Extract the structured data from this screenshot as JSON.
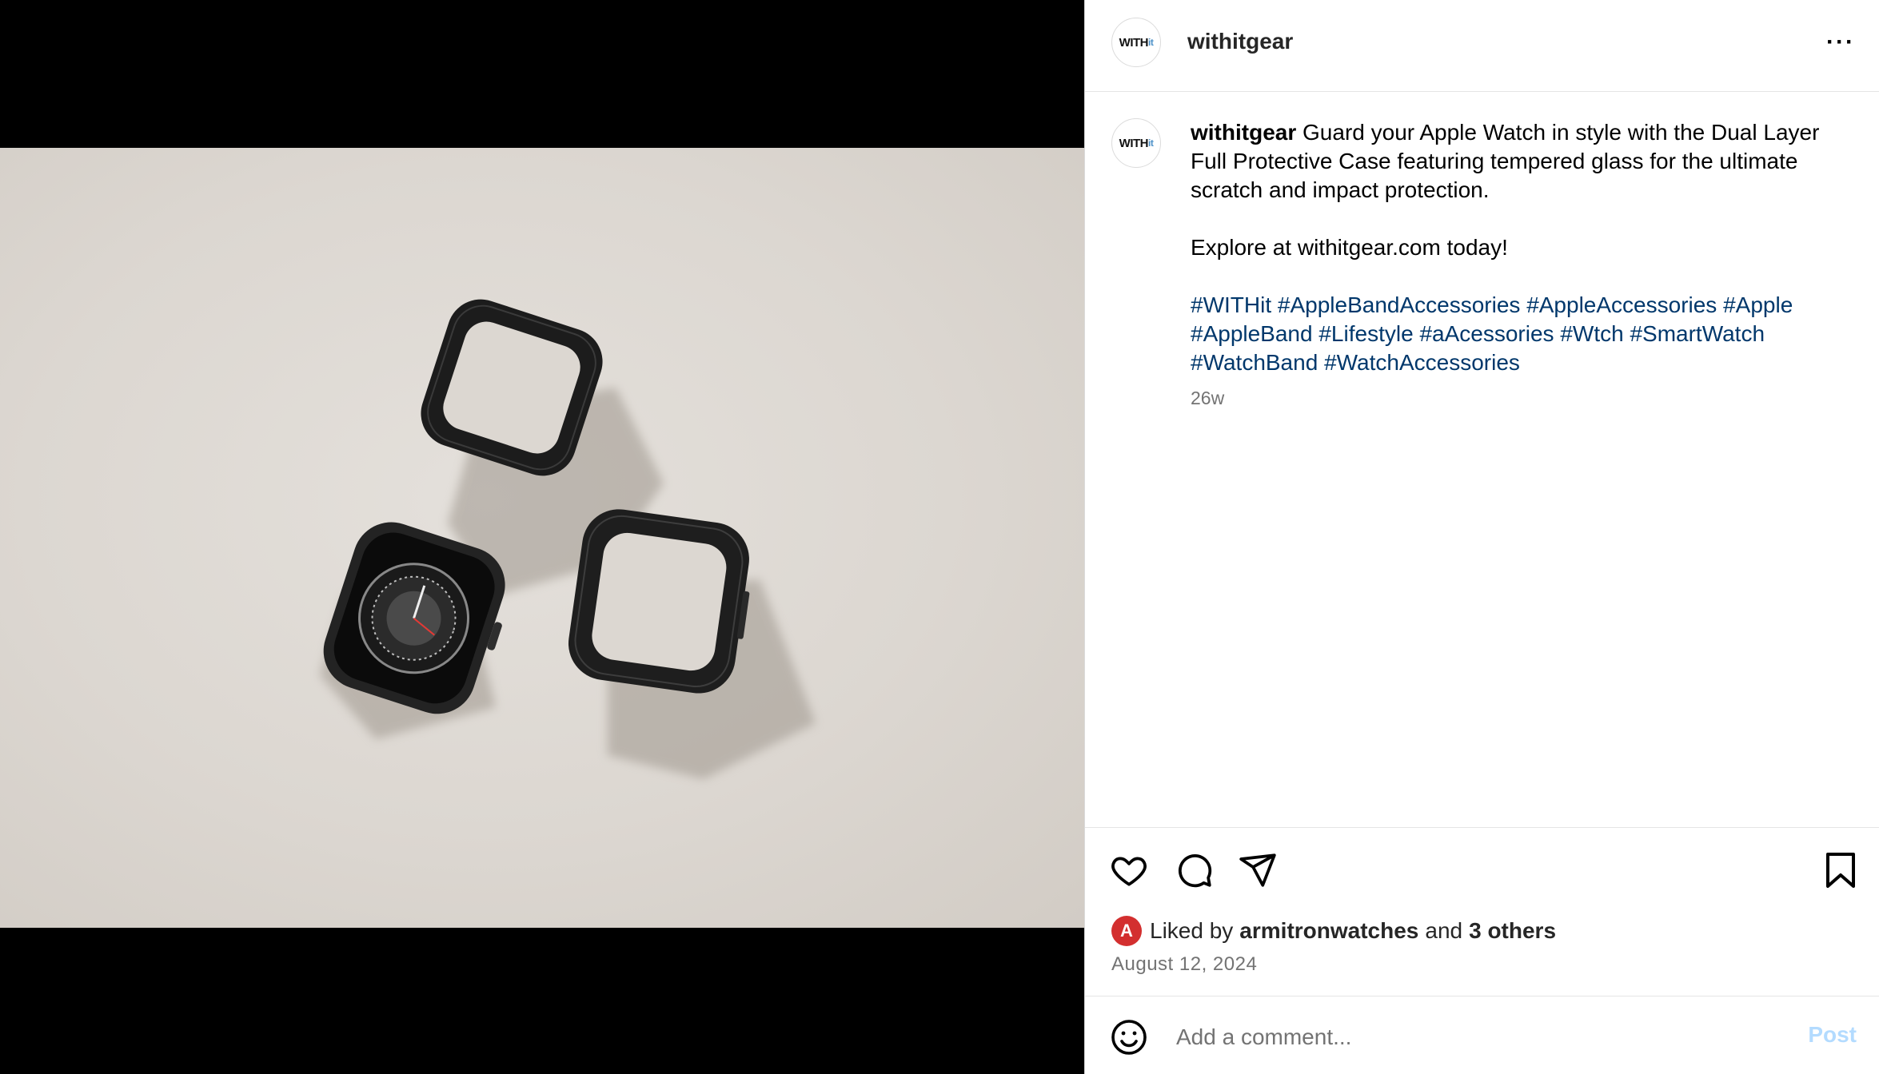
{
  "post": {
    "username": "withitgear",
    "avatar_text": "WITH",
    "avatar_suffix": "it",
    "caption_text": "Guard your Apple Watch in style with the Dual Layer Full Protective Case featuring tempered glass for the ultimate scratch and impact protection.",
    "caption_cta": "Explore at withitgear.com today!",
    "hashtags": [
      "#WITHit",
      "#AppleBandAccessories",
      "#AppleAccessories",
      "#Apple",
      "#AppleBand",
      "#Lifestyle",
      "#aAcessories",
      "#Wtch",
      "#SmartWatch",
      "#WatchBand",
      "#WatchAccessories"
    ],
    "age": "26w",
    "date": "August 12, 2024"
  },
  "likes": {
    "prefix": "Liked by",
    "user": "armitronwatches",
    "conjunction": "and",
    "others": "3 others",
    "liker_initial": "A"
  },
  "comment": {
    "placeholder": "Add a comment...",
    "post_label": "Post"
  },
  "header": {
    "more_label": "···"
  },
  "icons": [
    "heart-icon",
    "comment-icon",
    "share-icon",
    "bookmark-icon",
    "emoji-icon",
    "more-icon"
  ],
  "colors": {
    "hashtag": "#00376b",
    "post_disabled": "#b3dbff",
    "liker_avatar": "#d32f2f"
  }
}
